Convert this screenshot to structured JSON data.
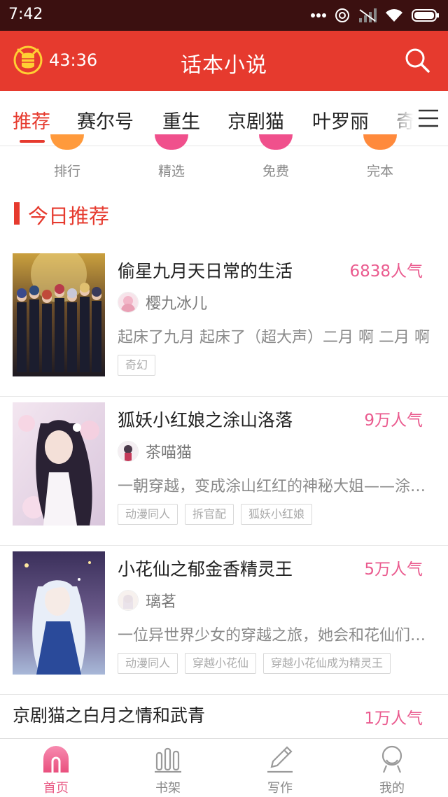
{
  "status_bar": {
    "time": "7:42"
  },
  "header": {
    "timer": "43:36",
    "title": "话本小说"
  },
  "tabs": [
    {
      "label": "推荐"
    },
    {
      "label": "赛尔号"
    },
    {
      "label": "重生"
    },
    {
      "label": "京剧猫"
    },
    {
      "label": "叶罗丽"
    },
    {
      "label": "奇"
    }
  ],
  "categories": [
    {
      "label": "排行",
      "color": "#ff9a3c"
    },
    {
      "label": "精选",
      "color": "#f0508c"
    },
    {
      "label": "免费",
      "color": "#f0508c"
    },
    {
      "label": "完本",
      "color": "#ff8a3c"
    }
  ],
  "section": {
    "title": "今日推荐"
  },
  "books": [
    {
      "title": "偷星九月天日常的生活",
      "popularity": "6838人气",
      "author": "樱九冰儿",
      "description": "起床了九月 起床了（超大声）二月 啊 二月 啊",
      "tags": [
        "奇幻"
      ]
    },
    {
      "title": "狐妖小红娘之涂山洛落",
      "popularity": "9万人气",
      "author": "茶喵猫",
      "description": "一朝穿越，变成涂山红红的神秘大姐——涂山洛落",
      "tags": [
        "动漫同人",
        "拆官配",
        "狐妖小红娘"
      ]
    },
    {
      "title": "小花仙之郁金香精灵王",
      "popularity": "5万人气",
      "author": "璃茗",
      "description": "一位异世界少女的穿越之旅，她会和花仙们一起",
      "tags": [
        "动漫同人",
        "穿越小花仙",
        "穿越小花仙成为精灵王"
      ]
    }
  ],
  "partial_book": {
    "title": "京剧猫之白月之情和武青",
    "popularity": "1万人气"
  },
  "bottom_nav": [
    {
      "label": "首页",
      "icon": "home-icon"
    },
    {
      "label": "书架",
      "icon": "bookshelf-icon"
    },
    {
      "label": "写作",
      "icon": "pen-icon"
    },
    {
      "label": "我的",
      "icon": "user-icon"
    }
  ],
  "colors": {
    "brand": "#e63a2e",
    "popularity": "#ea5a8e",
    "active_nav": "#e95b85"
  }
}
